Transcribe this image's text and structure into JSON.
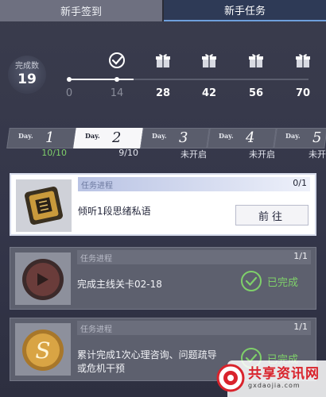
{
  "tabs": [
    {
      "label": "新手签到",
      "active": false
    },
    {
      "label": "新手任务",
      "active": true
    }
  ],
  "progress": {
    "label": "完成数",
    "count": "19",
    "milestones": [
      {
        "value": "0",
        "icon": "dot"
      },
      {
        "value": "14",
        "icon": "check-circle-icon"
      },
      {
        "value": "28",
        "icon": "gift-icon"
      },
      {
        "value": "42",
        "icon": "gift-icon"
      },
      {
        "value": "56",
        "icon": "gift-icon"
      },
      {
        "value": "70",
        "icon": "gift-icon"
      }
    ],
    "filled_fraction": 0.27
  },
  "days": [
    {
      "word": "Day.",
      "num": "1",
      "status": "10/10",
      "active": false
    },
    {
      "word": "Day.",
      "num": "2",
      "status": "9/10",
      "active": true
    },
    {
      "word": "Day.",
      "num": "3",
      "status": "未开启",
      "active": false
    },
    {
      "word": "Day.",
      "num": "4",
      "status": "未开启",
      "active": false
    },
    {
      "word": "Day.",
      "num": "5",
      "status": "未开",
      "active": false
    }
  ],
  "tasks": [
    {
      "header": "任务进程",
      "count": "0/1",
      "desc": "倾听1段思绪私语",
      "action": "前往",
      "state": "open"
    },
    {
      "header": "任务进程",
      "count": "1/1",
      "desc": "完成主线关卡02-18",
      "action": "已完成",
      "state": "done"
    },
    {
      "header": "任务进程",
      "count": "1/1",
      "desc_line1": "累计完成1次心理咨询、问题疏导",
      "desc_line2": "或危机干预",
      "action": "已完成",
      "state": "done"
    }
  ],
  "watermark": {
    "title": "共享资讯网",
    "url": "gxdaojia.com"
  },
  "colors": {
    "accent_green": "#7fd06a",
    "tab_active": "#2e3a56",
    "watermark_red": "#d9232c"
  }
}
